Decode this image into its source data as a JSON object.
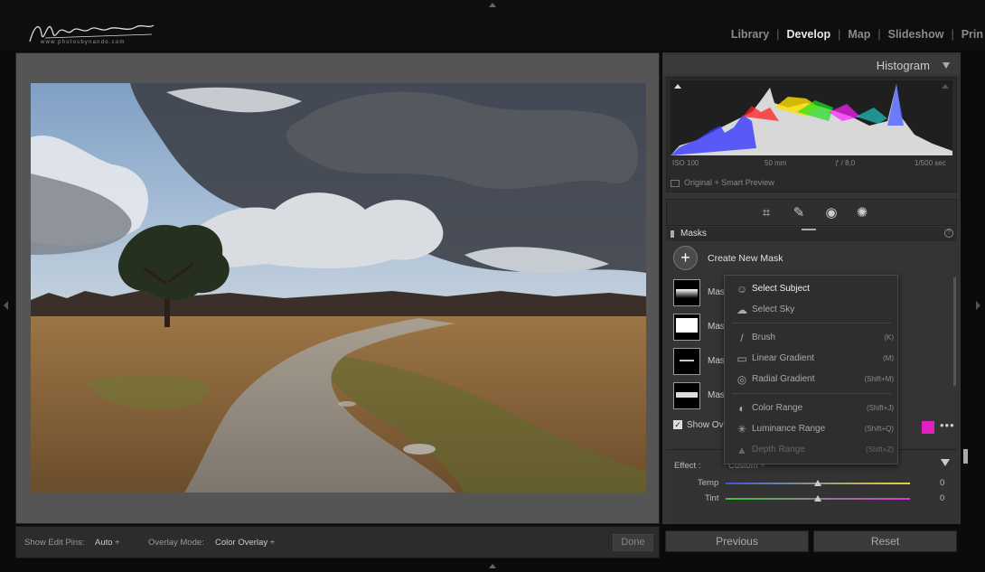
{
  "app": {
    "logo_signature": "Nando Harmsen",
    "logo_url": "www.photosbynando.com"
  },
  "modules": [
    "Library",
    "Develop",
    "Map",
    "Slideshow",
    "Prin"
  ],
  "active_module": "Develop",
  "histogram": {
    "title": "Histogram",
    "iso": "ISO 100",
    "focal": "50 mm",
    "aperture": "ƒ / 8,0",
    "shutter": "1/500 sec",
    "preview": "Original + Smart Preview"
  },
  "masks": {
    "title": "Masks",
    "create_label": "Create New Mask",
    "items": [
      {
        "label": "Mas"
      },
      {
        "label": "Mas"
      },
      {
        "label": "Mas"
      },
      {
        "label": "Mas"
      }
    ],
    "show_overlay_label": "Show Ove",
    "overlay_color": "#e020c0"
  },
  "menu": {
    "items": [
      {
        "label": "Select Subject",
        "shortcut": "",
        "icon": "person-icon"
      },
      {
        "label": "Select Sky",
        "shortcut": "",
        "icon": "sky-icon"
      },
      {
        "label": "Brush",
        "shortcut": "(K)",
        "icon": "brush-icon"
      },
      {
        "label": "Linear Gradient",
        "shortcut": "(M)",
        "icon": "linear-gradient-icon"
      },
      {
        "label": "Radial Gradient",
        "shortcut": "(Shift+M)",
        "icon": "radial-gradient-icon"
      },
      {
        "label": "Color Range",
        "shortcut": "(Shift+J)",
        "icon": "color-range-icon"
      },
      {
        "label": "Luminance Range",
        "shortcut": "(Shift+Q)",
        "icon": "luminance-range-icon"
      },
      {
        "label": "Depth Range",
        "shortcut": "(Shift+Z)",
        "icon": "depth-range-icon"
      }
    ]
  },
  "effect": {
    "label": "Effect :",
    "value": "Custom ÷",
    "sliders": [
      {
        "label": "Temp",
        "value": "0"
      },
      {
        "label": "Tint",
        "value": "0"
      }
    ]
  },
  "toolbar": {
    "edit_pins_label": "Show Edit Pins:",
    "edit_pins_value": "Auto ÷",
    "overlay_mode_label": "Overlay Mode:",
    "overlay_mode_value": "Color Overlay ÷",
    "done_label": "Done"
  },
  "buttons": {
    "previous": "Previous",
    "reset": "Reset"
  }
}
